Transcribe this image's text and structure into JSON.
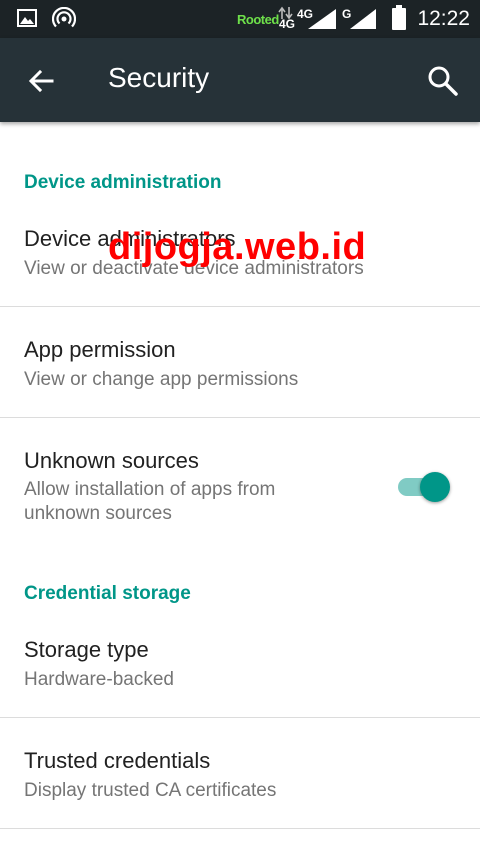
{
  "status_bar": {
    "rooted_label": "Rooted",
    "network_4g_label": "4G",
    "network_g_label": "G",
    "time": "12:22",
    "icons": [
      "image-icon",
      "hotspot-icon",
      "data-arrows-icon",
      "signal-4g-icon",
      "signal-g-icon",
      "battery-icon"
    ]
  },
  "toolbar": {
    "title": "Security",
    "back_icon": "arrow-back-icon",
    "search_icon": "search-icon"
  },
  "sections": {
    "device_admin": {
      "header": "Device administration",
      "items": [
        {
          "title": "Device administrators",
          "summary": "View or deactivate device administrators"
        },
        {
          "title": "App permission",
          "summary": "View or change app permissions"
        },
        {
          "title": "Unknown sources",
          "summary": "Allow installation of apps from unknown sources",
          "toggle_on": true
        }
      ]
    },
    "credential_storage": {
      "header": "Credential storage",
      "items": [
        {
          "title": "Storage type",
          "summary": "Hardware-backed"
        },
        {
          "title": "Trusted credentials",
          "summary": "Display trusted CA certificates"
        }
      ]
    }
  },
  "watermark": "dijogja.web.id",
  "colors": {
    "status_bar_bg": "#1c2326",
    "toolbar_bg": "#263238",
    "accent": "#009688",
    "accent_light": "#80cbc4",
    "watermark": "#ff0000"
  }
}
